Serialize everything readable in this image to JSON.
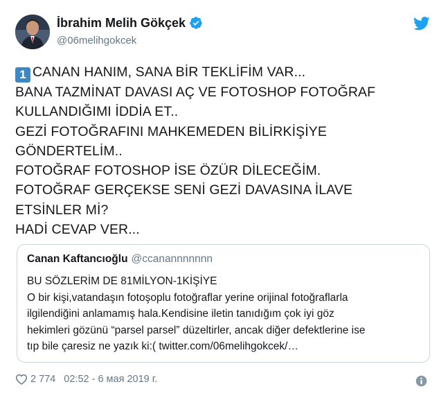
{
  "author": {
    "display_name": "İbrahim Melih Gökçek",
    "handle": "@06melihgokcek",
    "verified": true
  },
  "tweet": {
    "keycap_number": "1",
    "lines": [
      "CANAN HANIM, SANA BİR TEKLİFİM VAR...",
      "BANA TAZMİNAT DAVASI AÇ VE FOTOSHOP FOTOĞRAF",
      "KULLANDIĞIMI İDDİA ET..",
      "GEZİ FOTOĞRAFINI MAHKEMEDEN BİLİRKİŞİYE",
      "GÖNDERTELİM..",
      "FOTOĞRAF FOTOSHOP İSE ÖZÜR DİLECEĞİM.",
      "FOTOĞRAF GERÇEKSE SENİ GEZİ DAVASINA İLAVE",
      "ETSİNLER Mİ?",
      "HADİ CEVAP VER..."
    ]
  },
  "quoted_tweet": {
    "display_name": "Canan Kaftancıoğlu",
    "handle": "@ccanannnnnnn",
    "lines": [
      "BU SÖZLERİM DE 81MİLYON-1KİŞİYE",
      "O bir kişi,vatandaşın fotoşoplu fotoğraflar yerine orijinal fotoğraflarla",
      "ilgilendiğini anlamamış hala.Kendisine iletin tanıdığım çok iyi göz",
      "hekimleri gözünü “parsel parsel” düzeltirler, ancak diğer defektlerine ise",
      "tıp bile çaresiz ne yazık ki:( twitter.com/06melihgokcek/…"
    ]
  },
  "footer": {
    "likes": "2 774",
    "timestamp": "02:52 - 6 мая 2019 г."
  },
  "icons": {
    "verified": "verified-badge-icon",
    "brand": "twitter-bird-icon",
    "like": "heart-icon",
    "info": "info-icon"
  },
  "colors": {
    "twitter_blue": "#1da1f2",
    "keycap_blue": "#3b88c3",
    "secondary_text": "#657786",
    "border": "#ccd6dd"
  }
}
